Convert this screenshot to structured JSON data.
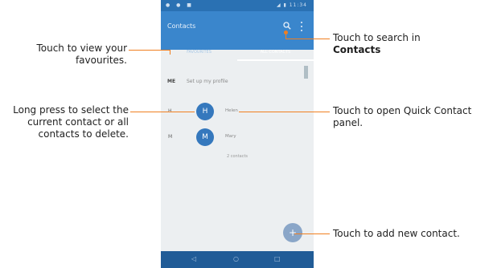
{
  "status_bar": {
    "left_icons": "● ● ■",
    "right_text": "◢ ▮ 11:34"
  },
  "app_bar": {
    "title": "Contacts",
    "search_icon": "search-icon",
    "more_icon": "more-vert-icon"
  },
  "tabs": [
    {
      "label": "FAVOURITES",
      "selected": false
    },
    {
      "label": "ALL CONTACTS",
      "selected": true
    }
  ],
  "me_row": {
    "label": "ME",
    "text": "Set up my profile"
  },
  "contacts": [
    {
      "letter": "H",
      "initial": "H",
      "name": "Helen"
    },
    {
      "letter": "M",
      "initial": "M",
      "name": "Mary"
    }
  ],
  "contact_count": "2 contacts",
  "fab": {
    "icon": "add-icon",
    "label": "+"
  },
  "nav_bar": {
    "back": "◁",
    "home": "○",
    "recents": "□"
  },
  "annotations": {
    "favourites": "Touch to view your favourites.",
    "long_press": "Long press to select the current contact or all contacts to delete.",
    "search_prefix": "Touch to search in",
    "search_bold": "Contacts",
    "quick_contact": "Touch to open Quick Contact panel.",
    "add_contact": "Touch to add new contact."
  },
  "colors": {
    "app_bar": "#3a86cc",
    "status_bar": "#2a71b3",
    "nav_bar": "#215c97",
    "accent_line": "#f07f20"
  }
}
